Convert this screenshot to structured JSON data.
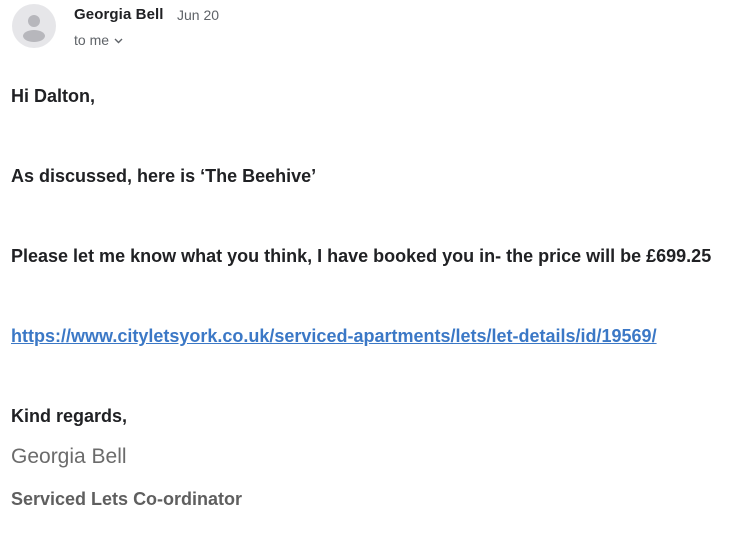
{
  "header": {
    "sender_name": "Georgia  Bell",
    "date": "Jun 20",
    "recipient": "to me",
    "avatar_icon": "person-icon",
    "chevron_icon": "chevron-down-icon"
  },
  "body": {
    "greeting": "Hi Dalton,",
    "line_discussed": "As discussed, here is ‘The Beehive’",
    "line_booking": "Please let me know what you think, I have booked you in- the price will be £699.25",
    "link": "https://www.cityletsyork.co.uk/serviced-apartments/lets/let-details/id/19569/",
    "closing": "Kind regards,"
  },
  "signature": {
    "name": "Georgia Bell",
    "title": "Serviced Lets Co-ordinator"
  },
  "colors": {
    "link": "#3b78c6",
    "text": "#202124",
    "muted": "#5f6368",
    "avatar_bg": "#e6e6e9"
  }
}
